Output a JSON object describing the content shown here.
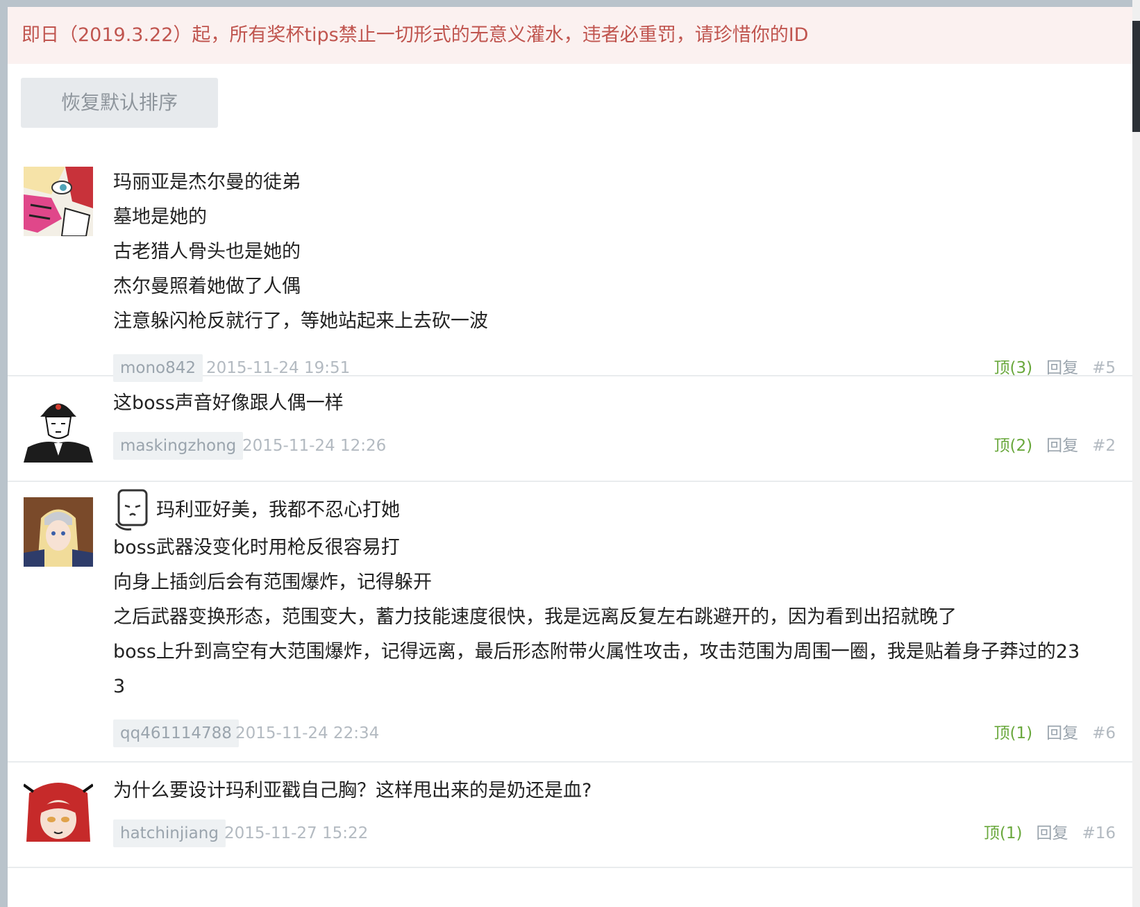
{
  "notice": "即日（2019.3.22）起，所有奖杯tips禁止一切形式的无意义灌水，违者必重罚，请珍惜你的ID",
  "sort_button": "恢复默认排序",
  "comments": [
    {
      "lines": [
        "玛丽亚是杰尔曼的徒弟",
        "墓地是她的",
        "古老猎人骨头也是她的",
        "杰尔曼照着她做了人偶",
        "注意躲闪枪反就行了，等她站起来上去砍一波"
      ],
      "user": "mono842",
      "time": "2015-11-24 19:51",
      "up": "顶(3)",
      "reply": "回复",
      "floor": "#5"
    },
    {
      "lines": [
        "这boss声音好像跟人偶一样"
      ],
      "user": "maskingzhong",
      "time": "2015-11-24 12:26",
      "up": "顶(2)",
      "reply": "回复",
      "floor": "#2"
    },
    {
      "lines": [
        "玛利亚好美，我都不忍心打她",
        "boss武器没变化时用枪反很容易打",
        "向身上插剑后会有范围爆炸，记得躲开",
        "之后武器变换形态，范围变大，蓄力技能速度很快，我是远离反复左右跳避开的，因为看到出招就晚了",
        "boss上升到高空有大范围爆炸，记得远离，最后形态附带火属性攻击，攻击范围为周围一圈，我是贴着身子莽过的23",
        "3"
      ],
      "user": "qq461114788",
      "time": "2015-11-24 22:34",
      "up": "顶(1)",
      "reply": "回复",
      "floor": "#6"
    },
    {
      "lines": [
        "为什么要设计玛利亚戳自己胸？这样甩出来的是奶还是血?"
      ],
      "user": "hatchinjiang",
      "time": "2015-11-27 15:22",
      "up": "顶(1)",
      "reply": "回复",
      "floor": "#16"
    }
  ]
}
